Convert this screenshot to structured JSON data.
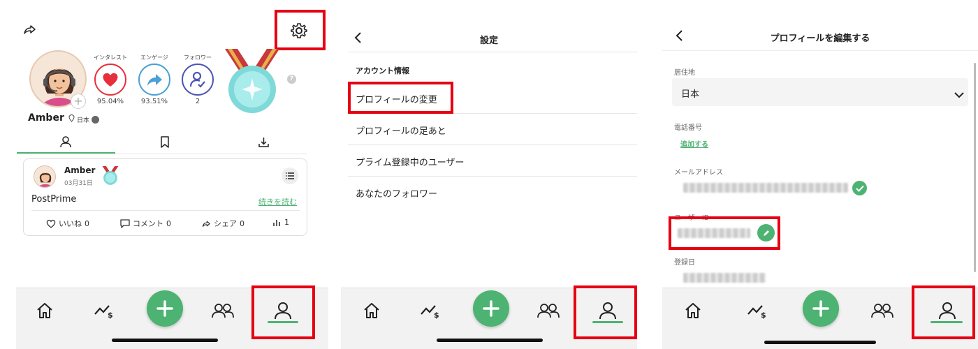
{
  "colors": {
    "accent": "#4db372",
    "highlight": "#e60012",
    "heart": "#e8303d",
    "share": "#4a9fd6",
    "follower": "#4a55b8"
  },
  "profile_screen": {
    "username": "Amber",
    "country": "日本",
    "stats": [
      {
        "label": "インタレスト",
        "value": "95.04%",
        "icon": "heart-icon"
      },
      {
        "label": "エンゲージ",
        "value": "93.51%",
        "icon": "share-arrow-icon"
      },
      {
        "label": "フォロワー",
        "value": "2",
        "icon": "follower-check-icon"
      }
    ],
    "help_mark": "?",
    "tabs": [
      "profile-tab-icon",
      "bookmark-icon",
      "download-icon"
    ],
    "post": {
      "author": "Amber",
      "date": "03月31日",
      "title": "PostPrime",
      "read_more": "続きを読む",
      "actions": [
        {
          "icon": "heart-outline-icon",
          "label": "いいね",
          "count": "0"
        },
        {
          "icon": "comment-icon",
          "label": "コメント",
          "count": "0"
        },
        {
          "icon": "share-icon",
          "label": "シェア",
          "count": "0"
        },
        {
          "icon": "bar-chart-icon",
          "label": "",
          "count": "1"
        }
      ]
    }
  },
  "settings_screen": {
    "title": "設定",
    "section": "アカウント情報",
    "items": [
      "プロフィールの変更",
      "プロフィールの足あと",
      "プライム登録中のユーザー",
      "あなたのフォロワー"
    ]
  },
  "edit_screen": {
    "title": "プロフィールを編集する",
    "residence_label": "居住地",
    "residence_value": "日本",
    "phone_label": "電話番号",
    "phone_add": "追加する",
    "email_label": "メールアドレス",
    "userid_label": "ユーザーID",
    "registered_label": "登録日"
  },
  "nav": [
    "home-icon",
    "market-icon",
    "plus-icon",
    "community-icon",
    "profile-icon"
  ]
}
